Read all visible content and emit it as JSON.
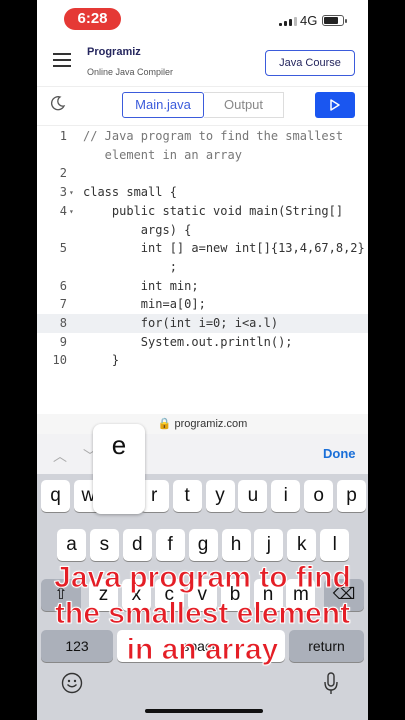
{
  "status": {
    "time": "6:28",
    "network": "4G"
  },
  "header": {
    "logo": "Programiz",
    "subtitle": "Online Java Compiler",
    "course_button": "Java Course"
  },
  "toolbar": {
    "tab_main": "Main.java",
    "tab_output": "Output"
  },
  "editor": {
    "lines": [
      {
        "num": "1",
        "text": "// Java program to find the smallest",
        "comment": true
      },
      {
        "num": "",
        "text": "   element in an array",
        "comment": true
      },
      {
        "num": "2",
        "text": ""
      },
      {
        "num": "3",
        "text": "class small {",
        "fold": true
      },
      {
        "num": "4",
        "text": "    public static void main(String[]",
        "fold": true
      },
      {
        "num": "",
        "text": "        args) {"
      },
      {
        "num": "5",
        "text": "        int [] a=new int[]{13,4,67,8,2}"
      },
      {
        "num": "",
        "text": "            ;"
      },
      {
        "num": "6",
        "text": "        int min;"
      },
      {
        "num": "7",
        "text": "        min=a[0];"
      },
      {
        "num": "8",
        "text": "        for(int i=0; i<a.l)",
        "active": true
      },
      {
        "num": "9",
        "text": "        System.out.println();"
      },
      {
        "num": "10",
        "text": "    }"
      }
    ]
  },
  "url": "programiz.com",
  "accessory": {
    "done_label": "Done"
  },
  "keyboard": {
    "popup_key": "e",
    "row1": [
      "q",
      "w",
      "e",
      "r",
      "t",
      "y",
      "u",
      "i",
      "o",
      "p"
    ],
    "row2": [
      "a",
      "s",
      "d",
      "f",
      "g",
      "h",
      "j",
      "k",
      "l"
    ],
    "row3": [
      "z",
      "x",
      "c",
      "v",
      "b",
      "n",
      "m"
    ],
    "row4": {
      "numbers": "123",
      "space": "space",
      "return": "return"
    }
  },
  "caption": {
    "line1": "Java program to find",
    "line2": "the smallest element",
    "line3": "in an array"
  },
  "colors": {
    "accent": "#1a56f0",
    "caption": "#e41e26",
    "time_pill": "#e53935"
  }
}
